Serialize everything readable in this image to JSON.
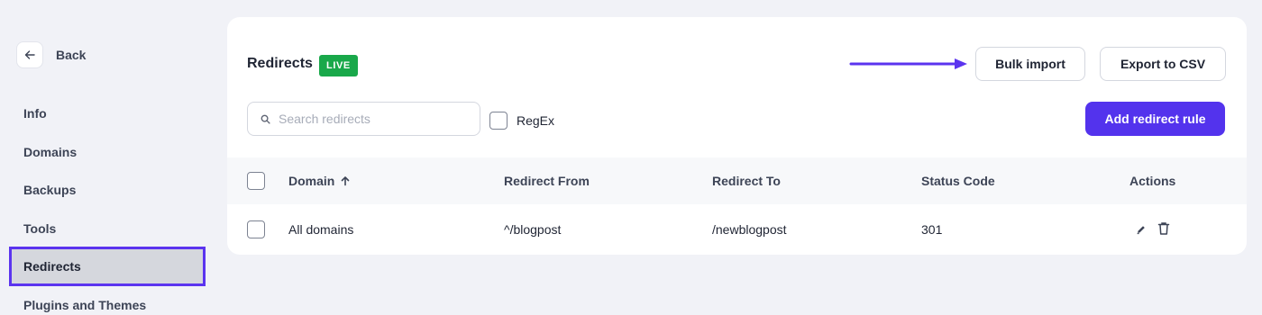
{
  "sidebar": {
    "back_label": "Back",
    "items": [
      {
        "label": "Info"
      },
      {
        "label": "Domains"
      },
      {
        "label": "Backups"
      },
      {
        "label": "Tools"
      },
      {
        "label": "Redirects",
        "active": true
      },
      {
        "label": "Plugins and Themes"
      }
    ]
  },
  "header": {
    "title": "Redirects",
    "badge": "LIVE",
    "bulk_import_label": "Bulk import",
    "export_label": "Export to CSV"
  },
  "toolbar": {
    "search_placeholder": "Search redirects",
    "search_value": "",
    "regex_label": "RegEx",
    "add_label": "Add redirect rule"
  },
  "table": {
    "columns": [
      "Domain",
      "Redirect From",
      "Redirect To",
      "Status Code",
      "Actions"
    ],
    "rows": [
      {
        "domain": "All domains",
        "from": "^/blogpost",
        "to": "/newblogpost",
        "status": "301"
      }
    ]
  },
  "icons": {
    "back": "arrow-left-icon",
    "search": "search-icon",
    "sort": "arrow-up-icon",
    "edit": "pencil-icon",
    "delete": "trash-icon",
    "annotation": "annotation-arrow-icon"
  },
  "colors": {
    "accent": "#5333ed",
    "highlight_border": "#5b34ef",
    "live_badge": "#19a84a",
    "page_bg": "#f1f2f7"
  }
}
